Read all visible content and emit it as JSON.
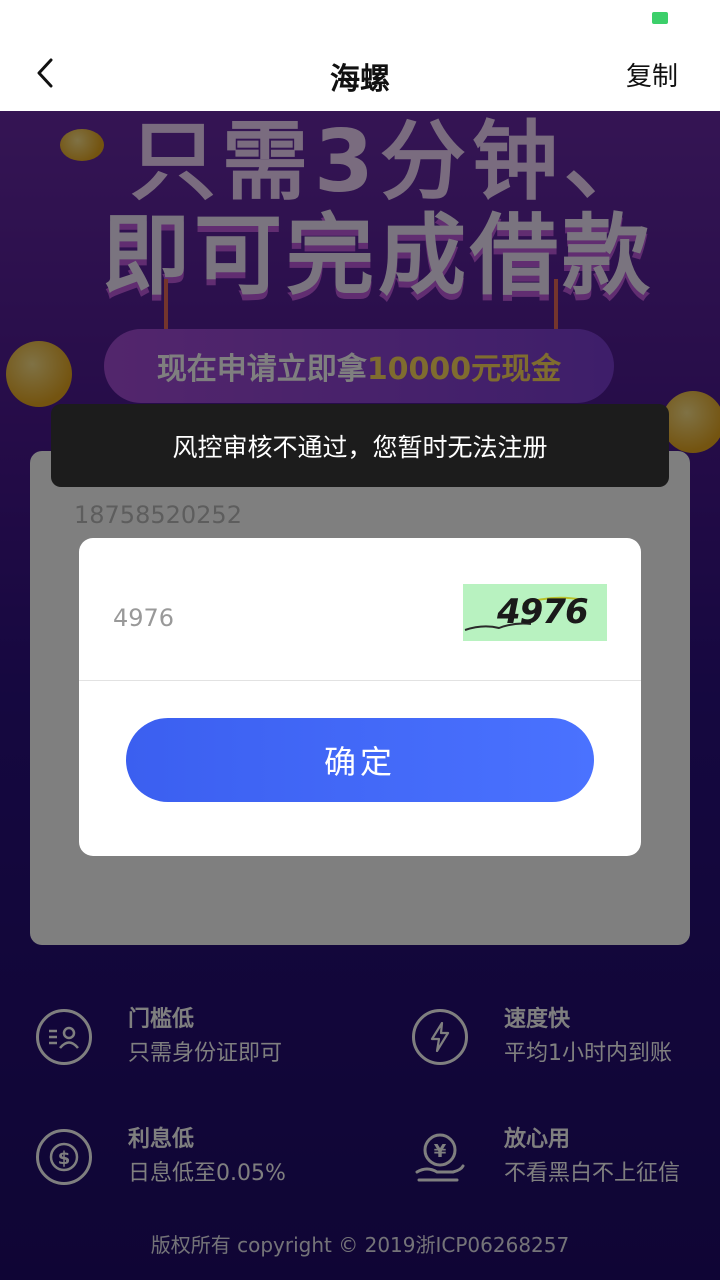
{
  "nav": {
    "title": "海螺",
    "action_label": "复制"
  },
  "banner": {
    "line1": "只需3分钟、",
    "line2": "即可完成借款",
    "sub_prefix": "现在申请立即拿",
    "sub_amount": "10000元现金"
  },
  "form": {
    "phone": "18758520252"
  },
  "features": [
    {
      "title": "门槛低",
      "desc": "只需身份证即可",
      "icon": "id-card-icon"
    },
    {
      "title": "速度快",
      "desc": "平均1小时内到账",
      "icon": "lightning-icon"
    },
    {
      "title": "利息低",
      "desc": "日息低至0.05%",
      "icon": "dollar-coin-icon"
    },
    {
      "title": "放心用",
      "desc": "不看黑白不上征信",
      "icon": "yuan-hand-icon"
    }
  ],
  "copyright": "版权所有 copyright © 2019浙ICP06268257",
  "toast": {
    "message": "风控审核不通过，您暂时无法注册"
  },
  "dialog": {
    "captcha_value": "4976",
    "captcha_image_text": "4976",
    "confirm_label": "确定"
  },
  "colors": {
    "primary": "#4a6cff",
    "battery": "#3ccf6a",
    "background": "#2a0e6e"
  }
}
